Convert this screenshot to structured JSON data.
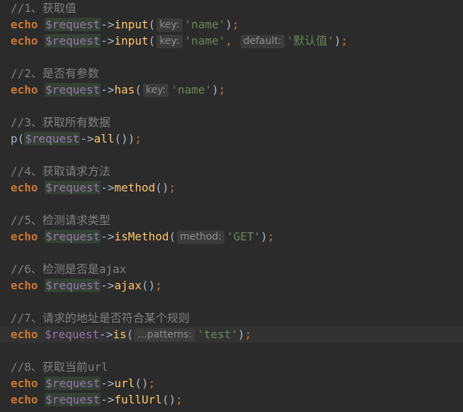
{
  "code": {
    "comment_1": "//1、获取值",
    "kw_echo": "echo",
    "var_request": "$request",
    "arrow": "->",
    "fn_input": "input",
    "hint_key": "key:",
    "hint_default": "default:",
    "str_name": "'name'",
    "str_default_value": "'默认值'",
    "comment_2": "//2、是否有参数",
    "fn_has": "has",
    "comment_3": "//3、获取所有数据",
    "fn_p": "p",
    "fn_all": "all",
    "comment_4": "//4、获取请求方法",
    "fn_method": "method",
    "comment_5": "//5、检测请求类型",
    "fn_isMethod": "isMethod",
    "hint_method": "method:",
    "str_get": "'GET'",
    "comment_6": "//6、检测是否是ajax",
    "fn_ajax": "ajax",
    "comment_7": "//7、请求的地址是否符合某个规则",
    "fn_is": "is",
    "hint_patterns": "...patterns:",
    "str_test": "'test'",
    "comment_8": "//8、获取当前url",
    "fn_url": "url",
    "fn_fullUrl": "fullUrl"
  },
  "colors": {
    "background": "#2b2b2b",
    "current_line": "#323232",
    "comment": "#808080",
    "keyword": "#cc7832",
    "variable": "#9876aa",
    "variable_highlight": "#344134",
    "function": "#ffc66d",
    "string": "#6a8759",
    "hint_background": "#3b3b3b"
  }
}
